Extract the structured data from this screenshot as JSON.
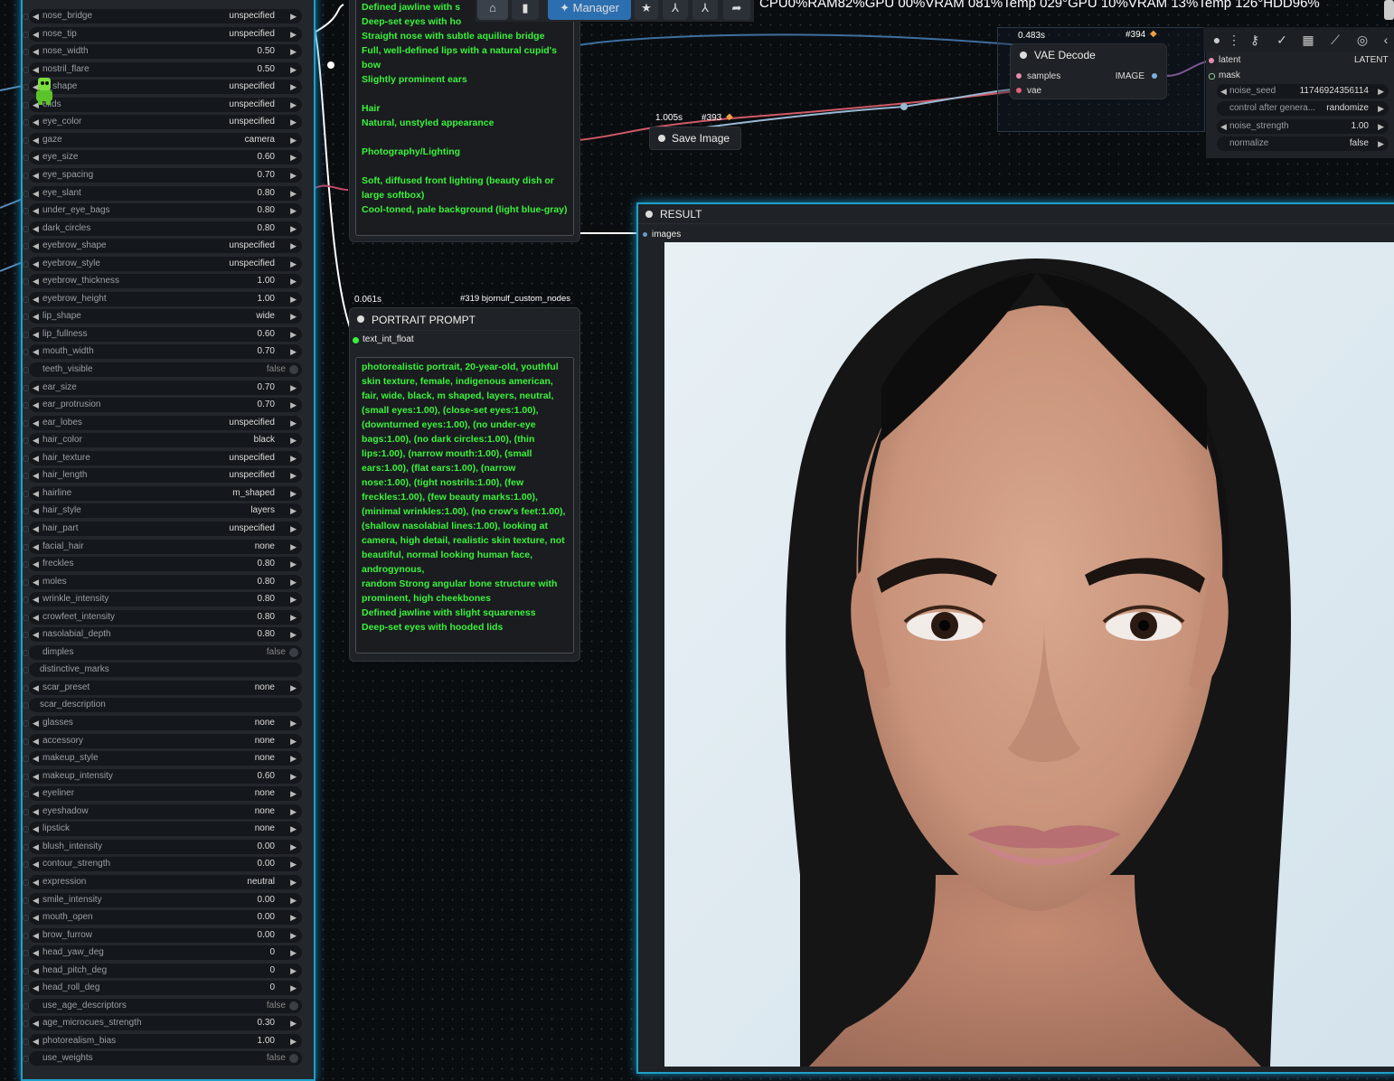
{
  "params": [
    {
      "name": "nose_bridge",
      "value": "unspecified",
      "kind": "combo"
    },
    {
      "name": "nose_tip",
      "value": "unspecified",
      "kind": "combo"
    },
    {
      "name": "nose_width",
      "value": "0.50",
      "kind": "number"
    },
    {
      "name": "nostril_flare",
      "value": "0.50",
      "kind": "number"
    },
    {
      "name": "e_shape",
      "value": "unspecified",
      "kind": "combo"
    },
    {
      "name": "elids",
      "value": "unspecified",
      "kind": "combo"
    },
    {
      "name": "eye_color",
      "value": "unspecified",
      "kind": "combo"
    },
    {
      "name": "gaze",
      "value": "camera",
      "kind": "combo"
    },
    {
      "name": "eye_size",
      "value": "0.60",
      "kind": "number"
    },
    {
      "name": "eye_spacing",
      "value": "0.70",
      "kind": "number"
    },
    {
      "name": "eye_slant",
      "value": "0.80",
      "kind": "number"
    },
    {
      "name": "under_eye_bags",
      "value": "0.80",
      "kind": "number"
    },
    {
      "name": "dark_circles",
      "value": "0.80",
      "kind": "number"
    },
    {
      "name": "eyebrow_shape",
      "value": "unspecified",
      "kind": "combo"
    },
    {
      "name": "eyebrow_style",
      "value": "unspecified",
      "kind": "combo"
    },
    {
      "name": "eyebrow_thickness",
      "value": "1.00",
      "kind": "number"
    },
    {
      "name": "eyebrow_height",
      "value": "1.00",
      "kind": "number"
    },
    {
      "name": "lip_shape",
      "value": "wide",
      "kind": "combo"
    },
    {
      "name": "lip_fullness",
      "value": "0.60",
      "kind": "number"
    },
    {
      "name": "mouth_width",
      "value": "0.70",
      "kind": "number"
    },
    {
      "name": "teeth_visible",
      "value": "false",
      "kind": "toggle"
    },
    {
      "name": "ear_size",
      "value": "0.70",
      "kind": "number"
    },
    {
      "name": "ear_protrusion",
      "value": "0.70",
      "kind": "number"
    },
    {
      "name": "ear_lobes",
      "value": "unspecified",
      "kind": "combo"
    },
    {
      "name": "hair_color",
      "value": "black",
      "kind": "combo"
    },
    {
      "name": "hair_texture",
      "value": "unspecified",
      "kind": "combo"
    },
    {
      "name": "hair_length",
      "value": "unspecified",
      "kind": "combo"
    },
    {
      "name": "hairline",
      "value": "m_shaped",
      "kind": "combo"
    },
    {
      "name": "hair_style",
      "value": "layers",
      "kind": "combo"
    },
    {
      "name": "hair_part",
      "value": "unspecified",
      "kind": "combo"
    },
    {
      "name": "facial_hair",
      "value": "none",
      "kind": "combo"
    },
    {
      "name": "freckles",
      "value": "0.80",
      "kind": "number"
    },
    {
      "name": "moles",
      "value": "0.80",
      "kind": "number"
    },
    {
      "name": "wrinkle_intensity",
      "value": "0.80",
      "kind": "number"
    },
    {
      "name": "crowfeet_intensity",
      "value": "0.80",
      "kind": "number"
    },
    {
      "name": "nasolabial_depth",
      "value": "0.80",
      "kind": "number"
    },
    {
      "name": "dimples",
      "value": "false",
      "kind": "toggle"
    },
    {
      "name": "distinctive_marks",
      "value": "",
      "kind": "text"
    },
    {
      "name": "scar_preset",
      "value": "none",
      "kind": "combo"
    },
    {
      "name": "scar_description",
      "value": "",
      "kind": "text"
    },
    {
      "name": "glasses",
      "value": "none",
      "kind": "combo"
    },
    {
      "name": "accessory",
      "value": "none",
      "kind": "combo"
    },
    {
      "name": "makeup_style",
      "value": "none",
      "kind": "combo"
    },
    {
      "name": "makeup_intensity",
      "value": "0.60",
      "kind": "number"
    },
    {
      "name": "eyeliner",
      "value": "none",
      "kind": "combo"
    },
    {
      "name": "eyeshadow",
      "value": "none",
      "kind": "combo"
    },
    {
      "name": "lipstick",
      "value": "none",
      "kind": "combo"
    },
    {
      "name": "blush_intensity",
      "value": "0.00",
      "kind": "number"
    },
    {
      "name": "contour_strength",
      "value": "0.00",
      "kind": "number"
    },
    {
      "name": "expression",
      "value": "neutral",
      "kind": "combo"
    },
    {
      "name": "smile_intensity",
      "value": "0.00",
      "kind": "number"
    },
    {
      "name": "mouth_open",
      "value": "0.00",
      "kind": "number"
    },
    {
      "name": "brow_furrow",
      "value": "0.00",
      "kind": "number"
    },
    {
      "name": "head_yaw_deg",
      "value": "0",
      "kind": "number"
    },
    {
      "name": "head_pitch_deg",
      "value": "0",
      "kind": "number"
    },
    {
      "name": "head_roll_deg",
      "value": "0",
      "kind": "number"
    },
    {
      "name": "use_age_descriptors",
      "value": "false",
      "kind": "toggle"
    },
    {
      "name": "age_microcues_strength",
      "value": "0.30",
      "kind": "number"
    },
    {
      "name": "photorealism_bias",
      "value": "1.00",
      "kind": "number"
    },
    {
      "name": "use_weights",
      "value": "false",
      "kind": "toggle"
    }
  ],
  "top_text_node": {
    "text": "Defined jawline with s\nDeep-set eyes with ho\nStraight nose with subtle aquiline bridge\nFull, well-defined lips with a natural cupid's bow\nSlightly prominent ears\n\nHair\nNatural, unstyled appearance\n\nPhotography/Lighting\n\nSoft, diffused front lighting (beauty dish or large softbox)\nCool-toned, pale background (light blue-gray)"
  },
  "prompt_node": {
    "time": "0.061s",
    "id": "#319 bjornulf_custom_nodes",
    "title": "PORTRAIT PROMPT",
    "output": "text_int_float",
    "text": "photorealistic portrait, 20-year-old, youthful skin texture, female, indigenous american, fair, wide, black, m shaped, layers, neutral, (small eyes:1.00), (close-set eyes:1.00), (downturned eyes:1.00), (no under-eye bags:1.00), (no dark circles:1.00), (thin lips:1.00), (narrow mouth:1.00), (small ears:1.00), (flat ears:1.00), (narrow nose:1.00), (tight nostrils:1.00), (few freckles:1.00), (few beauty marks:1.00), (minimal wrinkles:1.00), (no crow's feet:1.00), (shallow nasolabial lines:1.00), looking at camera, high detail, realistic skin texture, not beautiful, normal looking human face,\nandrogynous,\nrandom Strong angular bone structure with prominent, high cheekbones\nDefined jawline with slight squareness\nDeep-set eyes with hooded lids"
  },
  "toolbar": {
    "manager_label": "Manager",
    "stats": "CPU0%RAM82%GPU 00%VRAM 081%Temp 029°GPU 10%VRAM 13%Temp 126°HDD96%"
  },
  "save_node": {
    "time": "1.005s",
    "id": "#393",
    "title": "Save Image"
  },
  "vae_node": {
    "time": "0.483s",
    "id": "#394",
    "title": "VAE Decode",
    "in1": "samples",
    "in2": "vae",
    "out": "IMAGE"
  },
  "right_node": {
    "in1": "latent",
    "in1_type": "LATENT",
    "in2": "mask",
    "rows": [
      {
        "name": "noise_seed",
        "value": "11746924356114"
      },
      {
        "name": "control after genera...",
        "value": "randomize"
      },
      {
        "name": "noise_strength",
        "value": "1.00"
      },
      {
        "name": "normalize",
        "value": "false"
      }
    ]
  },
  "result_node": {
    "title": "RESULT",
    "input": "images"
  },
  "colors": {
    "accent": "#1ea1c9",
    "prompt_green": "#3bf23b",
    "toolbar_btn": "#2c6fb0"
  }
}
